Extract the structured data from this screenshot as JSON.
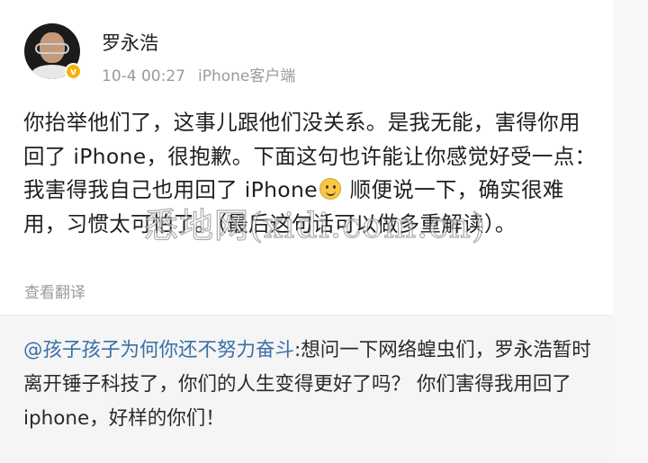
{
  "header": {
    "username": "罗永浩",
    "timestamp": "10-4 00:27",
    "source": "iPhone客户端",
    "badge_icon": "verified-v-icon",
    "badge_letter": "v"
  },
  "post": {
    "text_part1": "你抬举他们了，这事儿跟他们没关系。是我无能，害得你用回了 iPhone，很抱歉。下面这句也许能让你感觉好受一点：我害得我自己也用回了 iPhone",
    "emoji": "smile-emoji-icon",
    "text_part2": " 顺便说一下，确实很难用，习惯太可怕了。（最后这句话可以做多重解读）。",
    "translate_label": "查看翻译"
  },
  "repost": {
    "mention": "@孩子孩子为何你还不努力奋斗",
    "text": ":想问一下网络蝗虫们，罗永浩暂时离开锤子科技了，你们的人生变得更好了吗？ 你们害得我用回了iphone，好样的你们！"
  },
  "watermark": "悉地网(xidi.com.cn)",
  "colors": {
    "link": "#3a6fa8",
    "meta_text": "#9a9a9a",
    "badge": "#f5b20a",
    "repost_bg": "#f5f5f5"
  }
}
